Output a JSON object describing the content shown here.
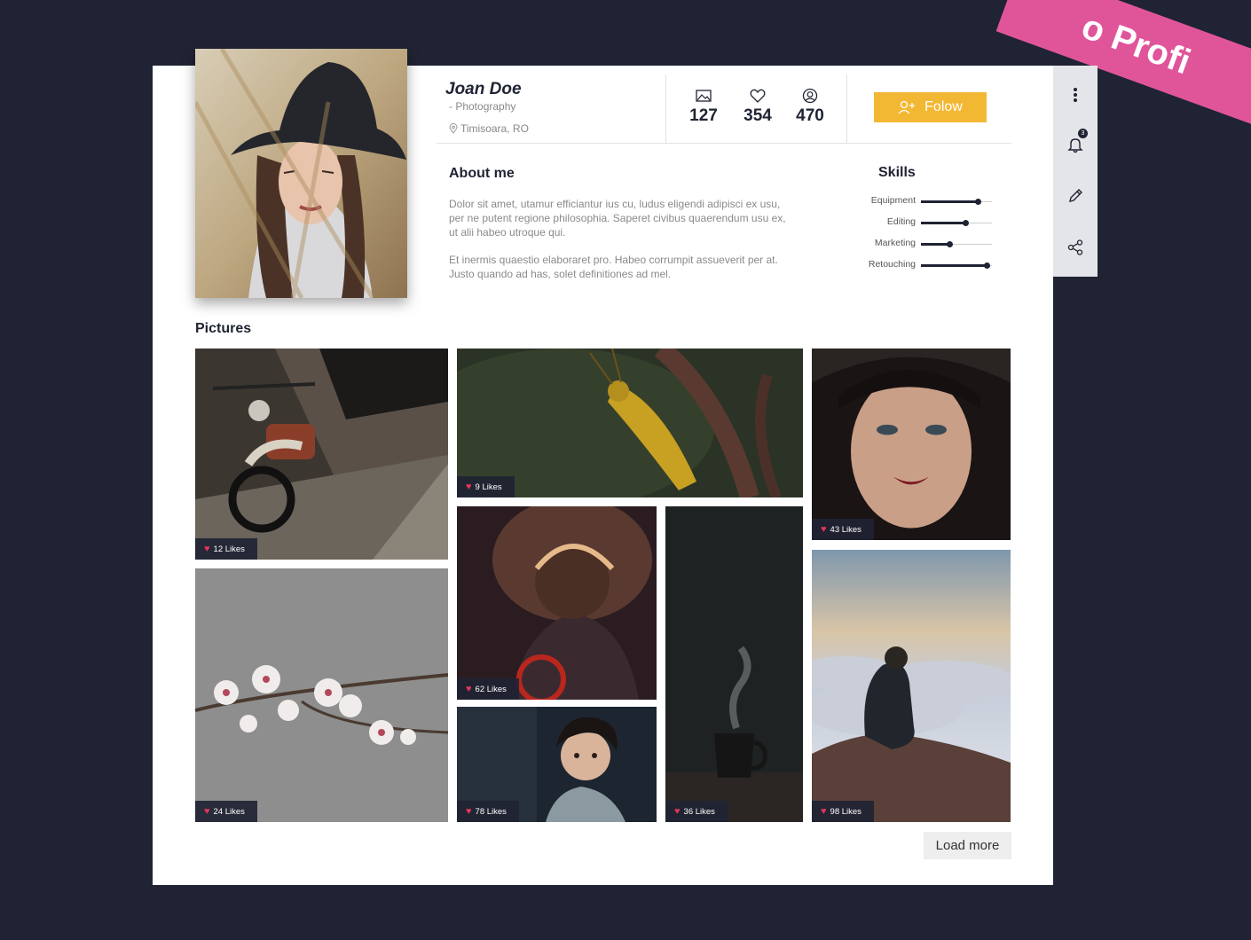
{
  "ribbon": "o Profi",
  "profile": {
    "name": "Joan Doe",
    "profession": "- Photography",
    "location": "Timisoara, RO",
    "follow_label": "Folow"
  },
  "stats": [
    {
      "icon": "image-icon",
      "value": "127"
    },
    {
      "icon": "heart-icon",
      "value": "354"
    },
    {
      "icon": "user-circle-icon",
      "value": "470"
    }
  ],
  "about": {
    "title": "About me",
    "paragraphs": [
      "Dolor sit amet, utamur efficiantur ius cu, ludus eligendi adipisci ex usu, per ne putent regione philosophia. Saperet civibus quaerendum usu ex, ut alii habeo utroque qui.",
      "Et inermis quaestio elaboraret pro. Habeo corrumpit assueverit per at. Justo quando ad has, solet definitiones ad mel."
    ]
  },
  "skills": {
    "title": "Skills",
    "items": [
      {
        "label": "Equipment",
        "level": 0.8
      },
      {
        "label": "Editing",
        "level": 0.62
      },
      {
        "label": "Marketing",
        "level": 0.4
      },
      {
        "label": "Retouching",
        "level": 0.92
      }
    ]
  },
  "pictures": {
    "title": "Pictures",
    "items": [
      {
        "subject": "motorcycle",
        "likes": "12 Likes"
      },
      {
        "subject": "grasshopper",
        "likes": "9 Likes"
      },
      {
        "subject": "woman-portrait",
        "likes": "43 Likes"
      },
      {
        "subject": "cherry-blossom",
        "likes": "24 Likes"
      },
      {
        "subject": "backlit-child",
        "likes": "62 Likes"
      },
      {
        "subject": "coffee-cup",
        "likes": "36 Likes"
      },
      {
        "subject": "man-above-clouds",
        "likes": "98 Likes"
      },
      {
        "subject": "curly-child",
        "likes": "78 Likes"
      }
    ],
    "load_more": "Load more"
  },
  "sidebar": {
    "notification_count": "3",
    "icons": [
      "more-vertical-icon",
      "bell-icon",
      "pencil-icon",
      "share-icon"
    ]
  },
  "colors": {
    "background": "#1f2333",
    "accent": "#f3b833",
    "ribbon": "#e0559a",
    "heart": "#e2345a"
  }
}
